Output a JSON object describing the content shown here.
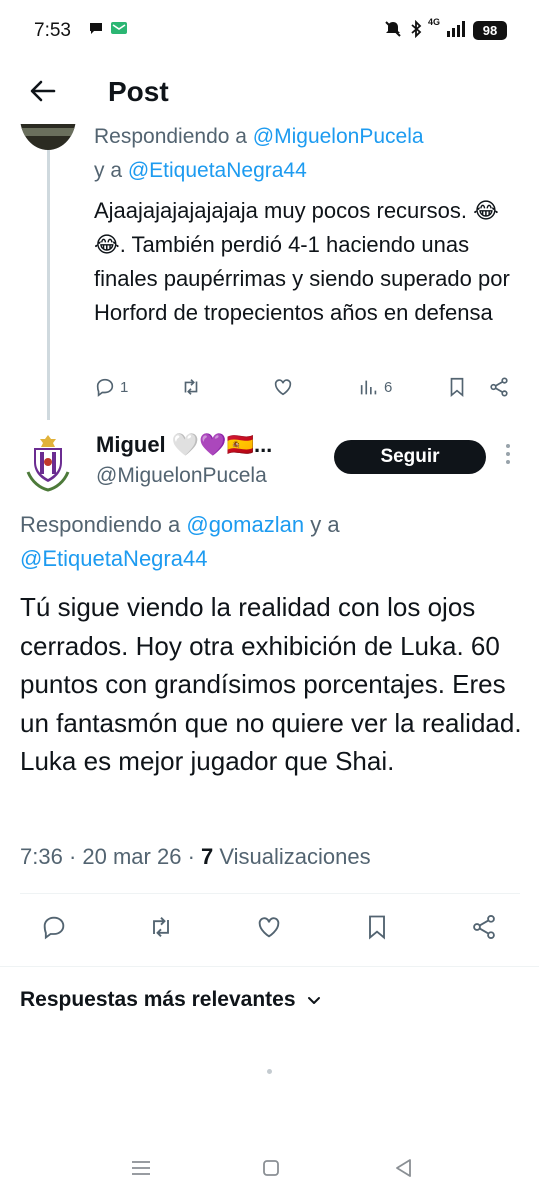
{
  "status_bar": {
    "time": "7:53",
    "network": "4G",
    "battery": "98"
  },
  "header": {
    "title": "Post"
  },
  "parent_reply": {
    "replying_prefix": "Respondiendo a ",
    "replying_to_1": "@MiguelonPucela",
    "replying_and": "y a ",
    "replying_to_2": "@EtiquetaNegra44",
    "text": "Ajaajajajajajajaja muy pocos recursos. 😂😂. También perdió 4-1 haciendo unas finales paupérrimas y siendo superado por Horford de tropecientos años en defensa",
    "reply_count": "1",
    "view_count": "6"
  },
  "main_post": {
    "display_name": "Miguel 🤍💜🇪🇸...",
    "handle": "@MiguelonPucela",
    "follow_label": "Seguir",
    "replying_prefix": "Respondiendo a ",
    "replying_to_1": "@gomazlan",
    "replying_and": " y a",
    "replying_to_2": "@EtiquetaNegra44",
    "text": "Tú sigue viendo la realidad con los ojos cerrados. Hoy otra exhibición de Luka. 60 puntos con grandísimos porcentajes. Eres un fantasmón que no quiere ver la realidad. Luka es mejor jugador que Shai.",
    "time": "7:36",
    "sep1": " · ",
    "date": "20 mar 26",
    "sep2": " · ",
    "views_count": "7",
    "views_label": " Visualizaciones"
  },
  "replies_section": {
    "label": "Respuestas más relevantes"
  },
  "colors": {
    "link": "#1d9bf0",
    "secondary_text": "#536471",
    "primary_text": "#0f1419",
    "follow_bg": "#0f1419"
  },
  "icons": [
    "back-arrow-icon",
    "reply-icon",
    "repost-icon",
    "like-icon",
    "views-icon",
    "bookmark-icon",
    "share-icon",
    "more-icon",
    "chevron-down-icon"
  ]
}
